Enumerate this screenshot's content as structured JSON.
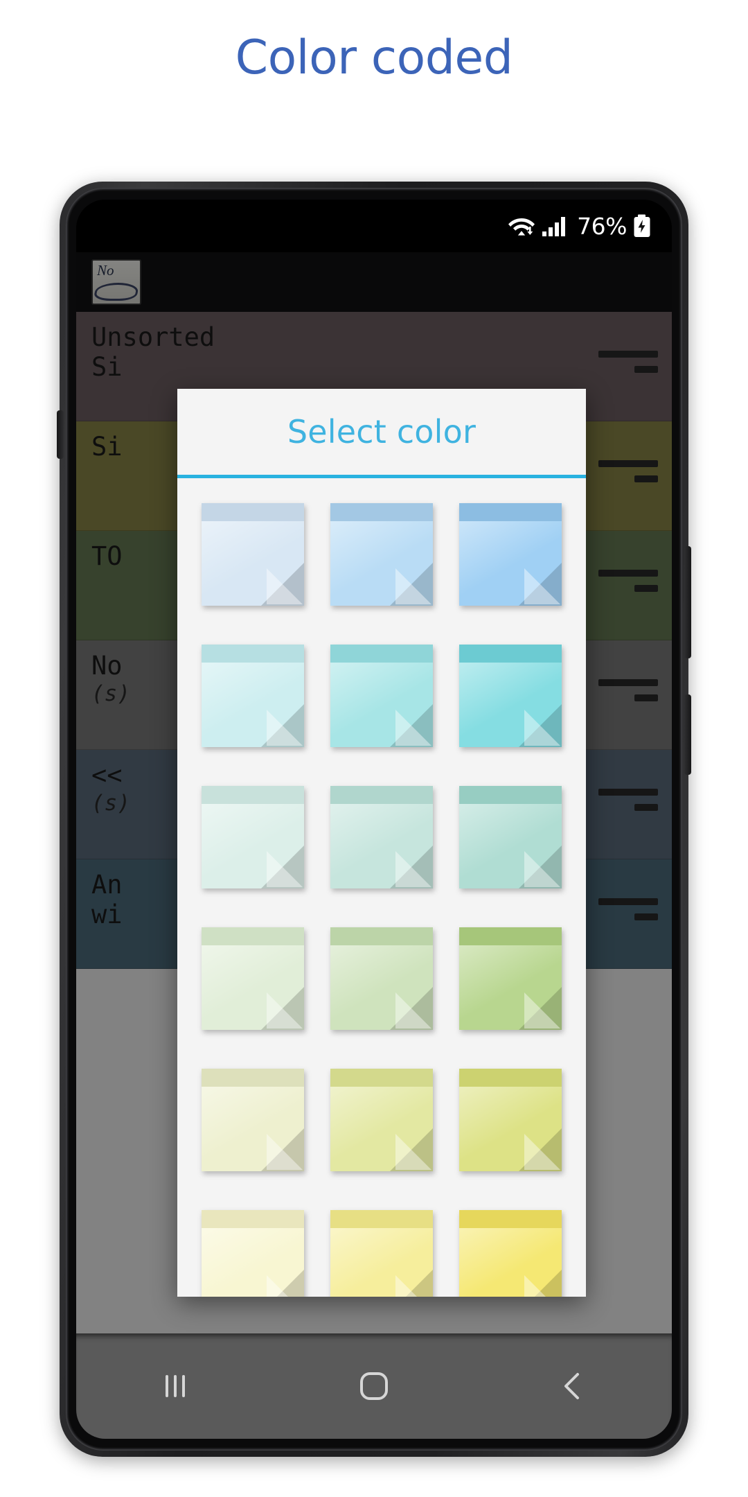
{
  "heading": "Color coded",
  "heading_color": "#3c64b8",
  "status_bar": {
    "battery_percent": "76%",
    "wifi_icon": "wifi-with-transfer-arrows-icon",
    "signal_icon": "cellular-signal-bars-icon",
    "battery_icon": "battery-charging-icon"
  },
  "app_behind": {
    "logo_word": "No",
    "rows": [
      {
        "title": "Unsorted\nSi",
        "sub": "",
        "bg": "#6e5e62"
      },
      {
        "title": "Si",
        "sub": "",
        "bg": "#8a8546"
      },
      {
        "title": "TO",
        "sub": "",
        "bg": "#677a53"
      },
      {
        "title": "No",
        "sub": "(s)",
        "bg": "#7b7b7b"
      },
      {
        "title": "<<",
        "sub": "(s)",
        "bg": "#5c6c7c"
      },
      {
        "title": "An\nwi",
        "sub": "",
        "bg": "#4d6b7c"
      }
    ]
  },
  "dialog": {
    "title": "Select color",
    "title_color": "#3fb3e0",
    "divider_color": "#29b2e0",
    "swatches": [
      {
        "name": "pale-blue",
        "body": "#d8e7f4",
        "head": "#c4d6e6"
      },
      {
        "name": "light-blue",
        "body": "#b9dcf5",
        "head": "#a3c8e4"
      },
      {
        "name": "blue",
        "body": "#a0d0f4",
        "head": "#8cbde2"
      },
      {
        "name": "pale-cyan",
        "body": "#cdeef0",
        "head": "#b6dfe2"
      },
      {
        "name": "light-cyan",
        "body": "#a7e5e6",
        "head": "#8fd5d8"
      },
      {
        "name": "cyan",
        "body": "#85dde2",
        "head": "#6ccbd2"
      },
      {
        "name": "pale-teal",
        "body": "#dcefe9",
        "head": "#c8e1db"
      },
      {
        "name": "light-teal",
        "body": "#c6e5dd",
        "head": "#b0d6cd"
      },
      {
        "name": "teal",
        "body": "#b0ddd3",
        "head": "#97cdc2"
      },
      {
        "name": "pale-green",
        "body": "#e1eed8",
        "head": "#cfe0c4"
      },
      {
        "name": "light-green",
        "body": "#cfe3bd",
        "head": "#bcd4a8"
      },
      {
        "name": "green",
        "body": "#b8d68f",
        "head": "#a6c67a"
      },
      {
        "name": "pale-yellow-green",
        "body": "#eef0cf",
        "head": "#dde0bb"
      },
      {
        "name": "light-yellow-green",
        "body": "#e3e8a2",
        "head": "#d3d98c"
      },
      {
        "name": "yellow-green",
        "body": "#dde286",
        "head": "#ccd270"
      },
      {
        "name": "pale-yellow",
        "body": "#f8f6d2",
        "head": "#e9e6bd"
      },
      {
        "name": "light-yellow",
        "body": "#f6ee9c",
        "head": "#e7df84"
      },
      {
        "name": "yellow",
        "body": "#f5e873",
        "head": "#e6d75c"
      }
    ]
  },
  "nav_bar": {
    "recents_label": "recents-button",
    "home_label": "home-button",
    "back_label": "back-button"
  }
}
